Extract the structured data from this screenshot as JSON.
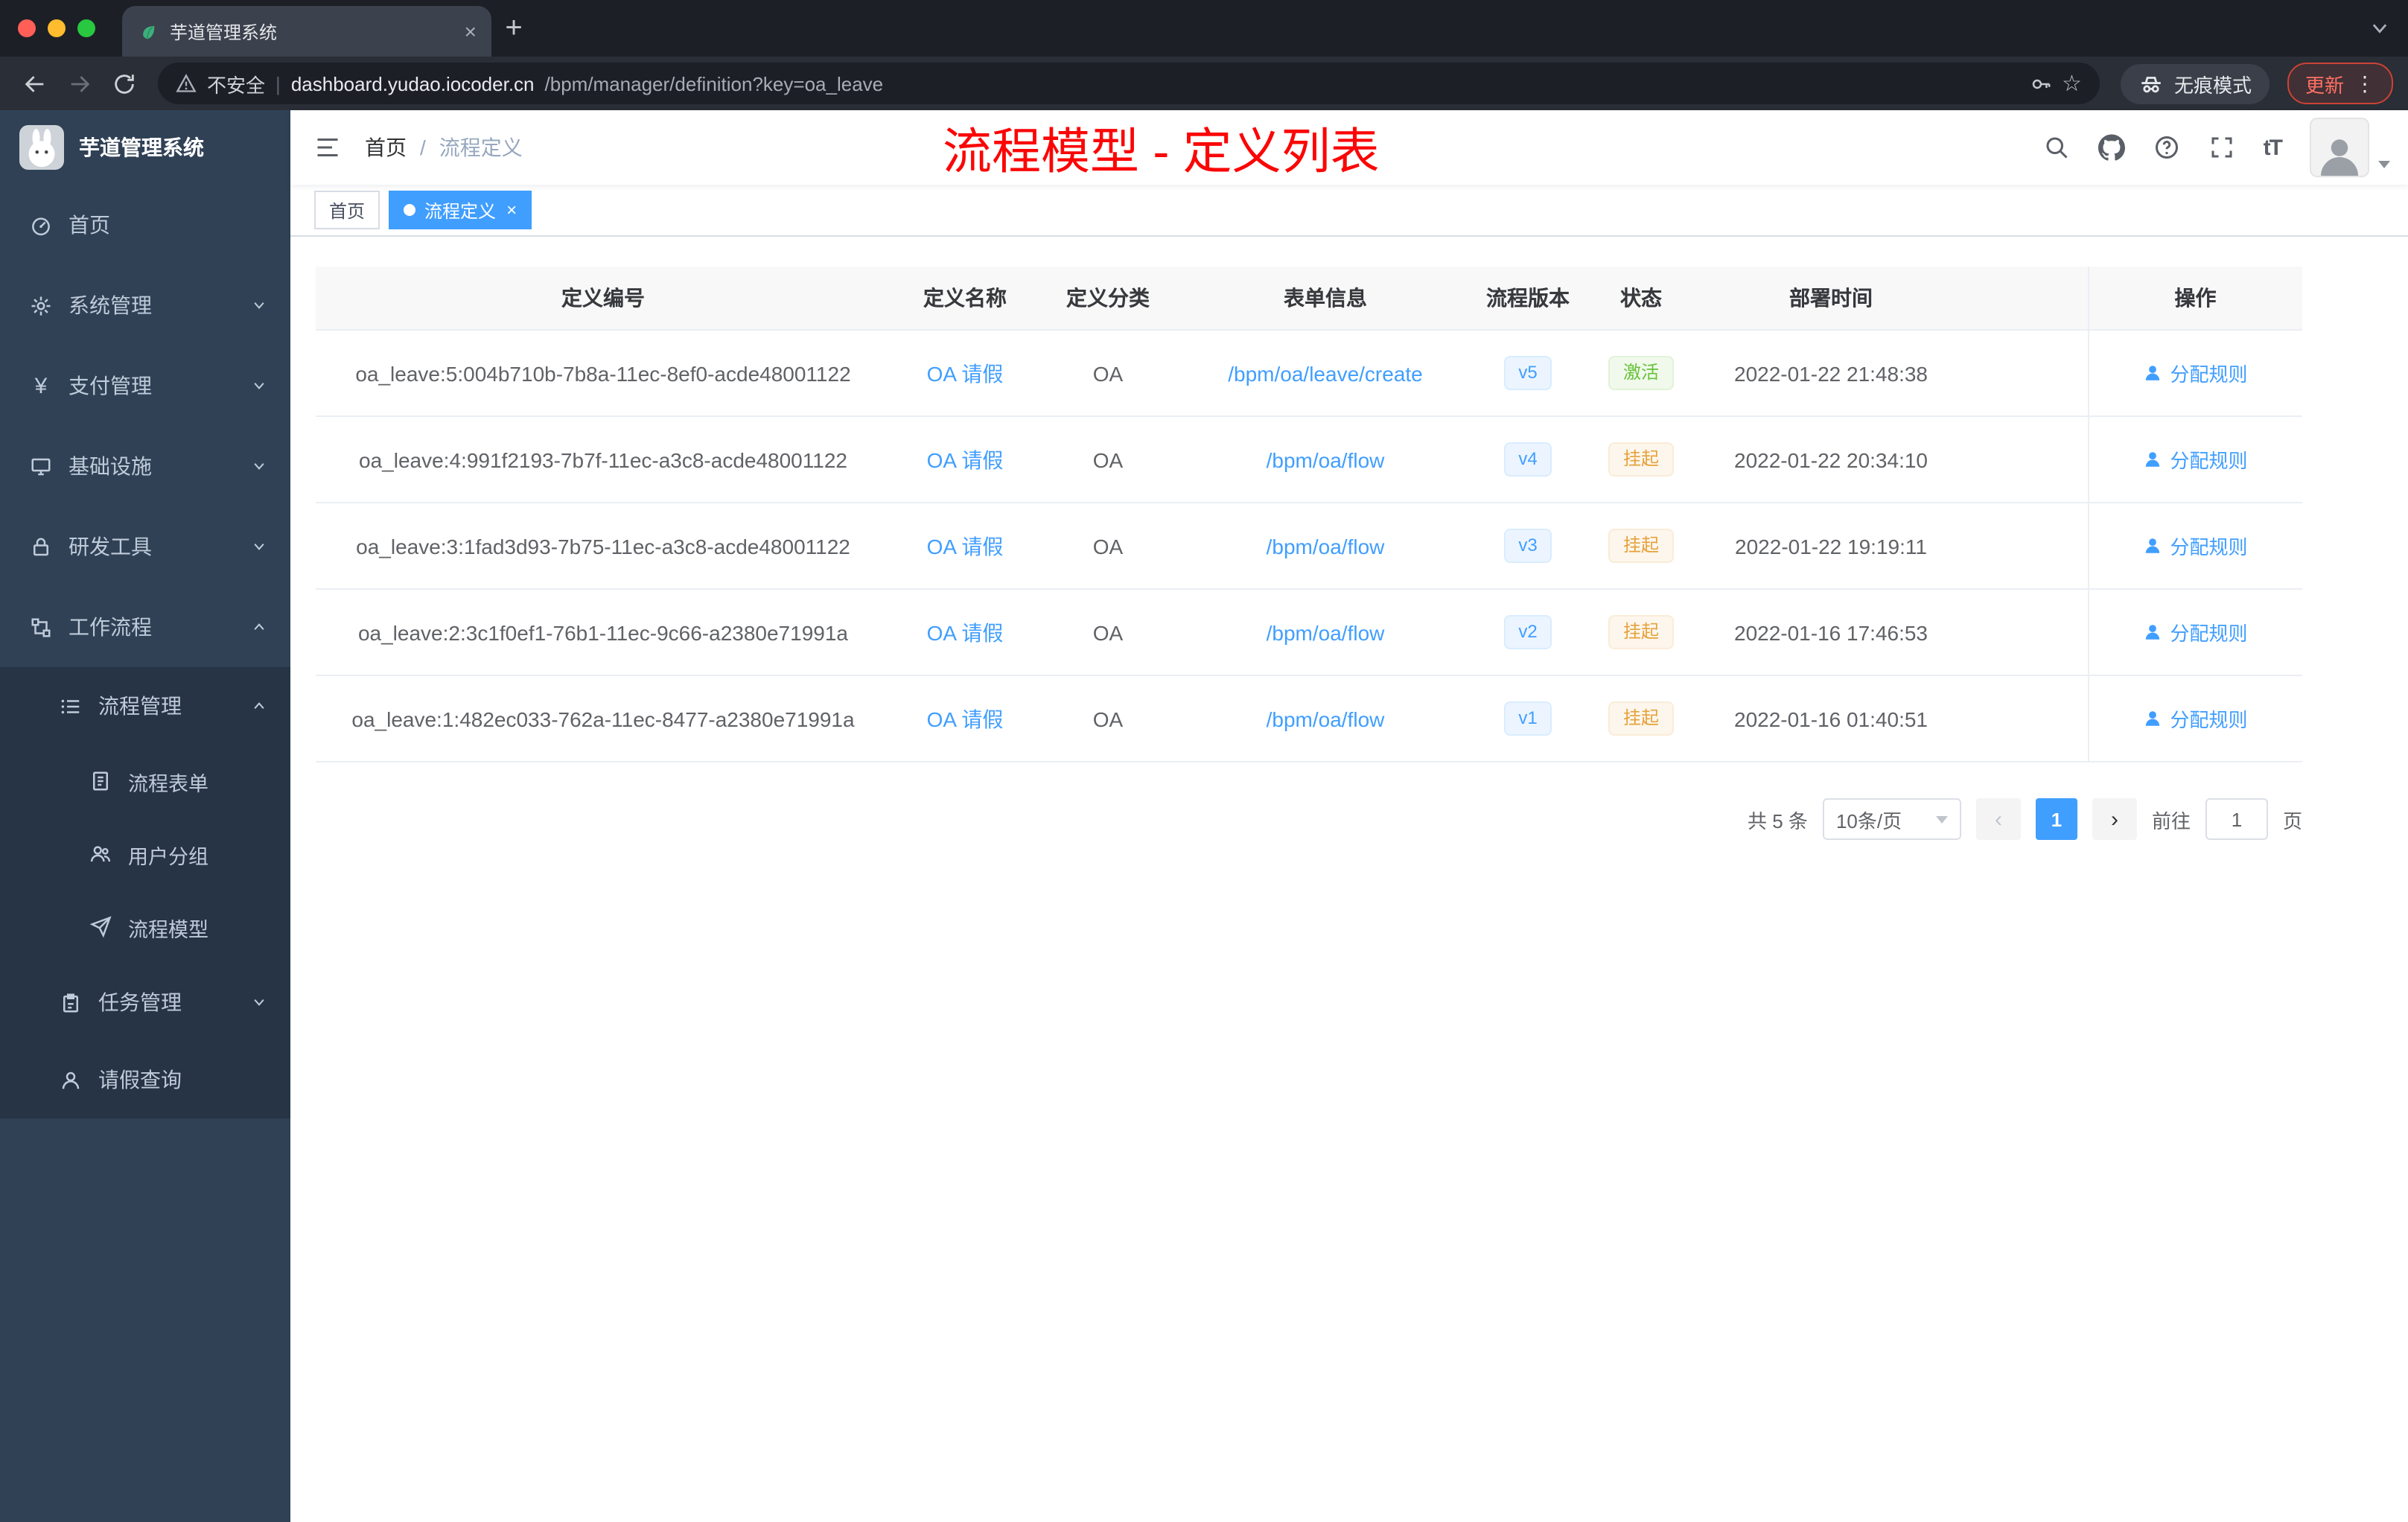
{
  "colors": {
    "accent": "#409eff",
    "success": "#67c23a",
    "warning": "#e6a23c",
    "annotation": "#fb0606"
  },
  "browser": {
    "tab_title": "芋道管理系统",
    "security_label": "不安全",
    "url_host": "dashboard.yudao.iocoder.cn",
    "url_path": "/bpm/manager/definition?key=oa_leave",
    "incognito_label": "无痕模式",
    "update_label": "更新"
  },
  "sidebar": {
    "logo_title": "芋道管理系统",
    "menu": [
      {
        "label": "首页"
      },
      {
        "label": "系统管理"
      },
      {
        "label": "支付管理"
      },
      {
        "label": "基础设施"
      },
      {
        "label": "研发工具"
      },
      {
        "label": "工作流程"
      }
    ],
    "submenu": [
      {
        "label": "流程管理"
      },
      {
        "label": "流程表单"
      },
      {
        "label": "用户分组"
      },
      {
        "label": "流程模型"
      },
      {
        "label": "任务管理"
      },
      {
        "label": "请假查询"
      }
    ]
  },
  "navbar": {
    "breadcrumb": [
      "首页",
      "流程定义"
    ],
    "separator": "/",
    "annotation": "流程模型 - 定义列表",
    "font_icon": "tT"
  },
  "tags": [
    {
      "label": "首页"
    },
    {
      "label": "流程定义"
    }
  ],
  "table": {
    "columns": {
      "id": "定义编号",
      "name": "定义名称",
      "category": "定义分类",
      "form": "表单信息",
      "version": "流程版本",
      "status": "状态",
      "deploy_time": "部署时间",
      "actions": "操作"
    },
    "rows": [
      {
        "id": "oa_leave:5:004b710b-7b8a-11ec-8ef0-acde48001122",
        "name": "OA 请假",
        "category": "OA",
        "form": "/bpm/oa/leave/create",
        "version": "v5",
        "status": "激活",
        "deploy_time": "2022-01-22 21:48:38",
        "action": "分配规则"
      },
      {
        "id": "oa_leave:4:991f2193-7b7f-11ec-a3c8-acde48001122",
        "name": "OA 请假",
        "category": "OA",
        "form": "/bpm/oa/flow",
        "version": "v4",
        "status": "挂起",
        "deploy_time": "2022-01-22 20:34:10",
        "action": "分配规则"
      },
      {
        "id": "oa_leave:3:1fad3d93-7b75-11ec-a3c8-acde48001122",
        "name": "OA 请假",
        "category": "OA",
        "form": "/bpm/oa/flow",
        "version": "v3",
        "status": "挂起",
        "deploy_time": "2022-01-22 19:19:11",
        "action": "分配规则"
      },
      {
        "id": "oa_leave:2:3c1f0ef1-76b1-11ec-9c66-a2380e71991a",
        "name": "OA 请假",
        "category": "OA",
        "form": "/bpm/oa/flow",
        "version": "v2",
        "status": "挂起",
        "deploy_time": "2022-01-16 17:46:53",
        "action": "分配规则"
      },
      {
        "id": "oa_leave:1:482ec033-762a-11ec-8477-a2380e71991a",
        "name": "OA 请假",
        "category": "OA",
        "form": "/bpm/oa/flow",
        "version": "v1",
        "status": "挂起",
        "deploy_time": "2022-01-16 01:40:51",
        "action": "分配规则"
      }
    ]
  },
  "pagination": {
    "total": "共 5 条",
    "page_size": "10条/页",
    "page": "1",
    "goto_label": "前往",
    "goto_value": "1",
    "goto_unit": "页"
  }
}
